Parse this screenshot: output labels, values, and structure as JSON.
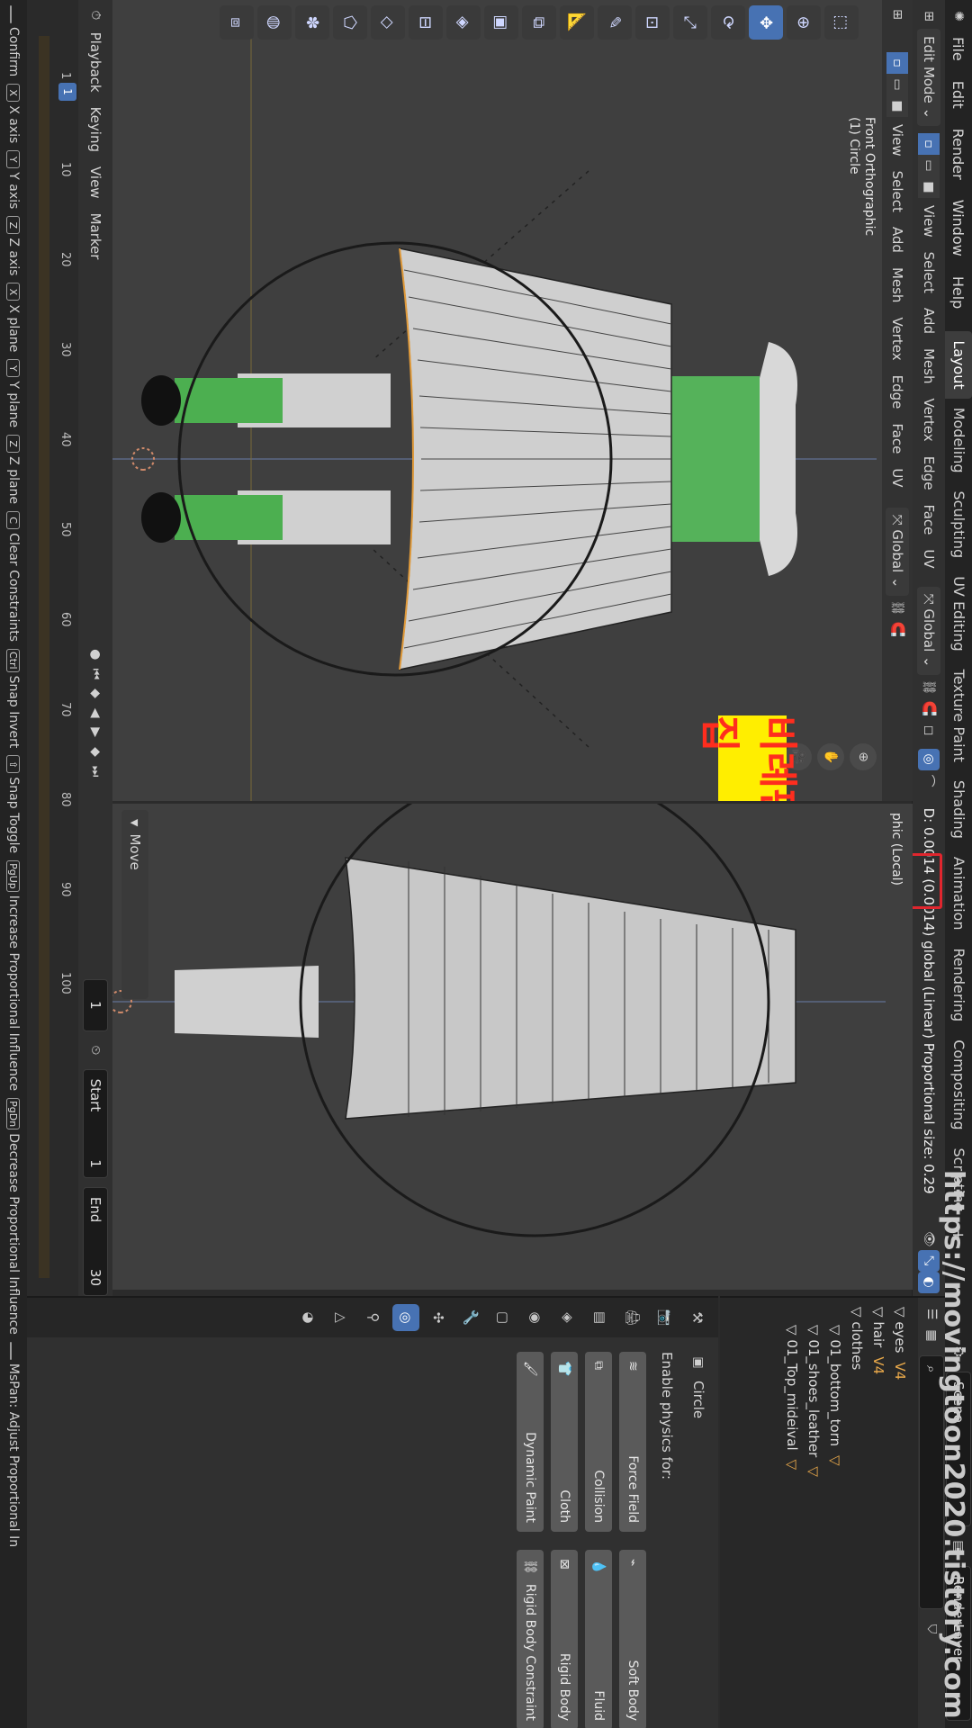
{
  "topbar": {
    "menus": [
      "File",
      "Edit",
      "Render",
      "Window",
      "Help"
    ],
    "workspaces": [
      "Layout",
      "Modeling",
      "Sculpting",
      "UV Editing",
      "Texture Paint",
      "Shading",
      "Animation",
      "Rendering",
      "Compositing",
      "Scripting"
    ],
    "active_workspace": "Layout",
    "scene": "Scene",
    "view_layer": "RenderLayer"
  },
  "header3d": {
    "mode": "Edit Mode",
    "menus": [
      "View",
      "Select",
      "Add",
      "Mesh",
      "Vertex",
      "Edge",
      "Face",
      "UV"
    ],
    "orientation": "Global",
    "operator_info": "D: 0.0014 (0.0014) global (Linear)  Proportional size: 0.29"
  },
  "left_view": {
    "mode": "Edit Mode",
    "menus": [
      "View",
      "Select",
      "Add",
      "Mesh",
      "Vertex",
      "Edge",
      "Face",
      "UV"
    ],
    "orientation": "Global",
    "label_line1": "Front Orthographic",
    "label_line2": "(1) Circle"
  },
  "right_view": {
    "label_line1": "Front Orthographic",
    "label_line2": "(1) Circle",
    "label_right": "phic (Local)"
  },
  "top_strip": {
    "label_line1": "Front Orthographic",
    "label_line2": "(1) Circle",
    "mode": "Edit Mo"
  },
  "move_panel": {
    "title": "Move"
  },
  "timeline": {
    "menus": [
      "Playback",
      "Keying",
      "View",
      "Marker"
    ],
    "current_frame": "1",
    "start_label": "Start",
    "start": "1",
    "end_label": "End",
    "end": "30",
    "ticks": [
      "1",
      "10",
      "20",
      "30",
      "40",
      "50",
      "60",
      "70",
      "80",
      "90",
      "100"
    ]
  },
  "outliner": {
    "rows": [
      {
        "name": "eyes",
        "tag": "V4"
      },
      {
        "name": "hair",
        "tag": "V4"
      },
      {
        "name": "clothes",
        "tag": ""
      },
      {
        "name": "01_bottom_torn",
        "tag": "▽"
      },
      {
        "name": "01_shoes_leather",
        "tag": "▽"
      },
      {
        "name": "01_Top_mideival",
        "tag": "▽"
      }
    ]
  },
  "properties": {
    "object": "Circle",
    "heading": "Enable physics for:",
    "buttons": [
      "Force Field",
      "Soft Body",
      "Collision",
      "Fluid",
      "Cloth",
      "Rigid Body",
      "Dynamic Paint",
      "Rigid Body Constraint"
    ]
  },
  "statusbar": {
    "items": [
      {
        "key": "",
        "label": "Confirm"
      },
      {
        "key": "X",
        "label": "X axis"
      },
      {
        "key": "Y",
        "label": "Y axis"
      },
      {
        "key": "Z",
        "label": "Z axis"
      },
      {
        "key": "X",
        "label": "X plane"
      },
      {
        "key": "Y",
        "label": "Y plane"
      },
      {
        "key": "Z",
        "label": "Z plane"
      },
      {
        "key": "C",
        "label": "Clear Constraints"
      },
      {
        "key": "Ctrl",
        "label": "Snap Invert"
      },
      {
        "key": "⇧",
        "label": "Snap Toggle"
      },
      {
        "key": "PgUp",
        "label": "Increase Proportional Influence"
      },
      {
        "key": "PgDn",
        "label": "Decrease Proportional Influence"
      },
      {
        "key": "",
        "label": "MsPan: Adjust Proportional In"
      }
    ]
  },
  "overlay_label": "비례편집",
  "watermark": "https://movingtoon2020.tistory.com",
  "corner_mark": "11",
  "colors": {
    "accent": "#4772b3",
    "highlight_box": "#e0262e",
    "overlay_bg": "#ffee00",
    "overlay_text": "#ff2d1e",
    "mesh_green": "#4caf50"
  },
  "icons": [
    "blender-logo-icon",
    "proportional-edit-icon",
    "falloff-icon",
    "snap-icon",
    "gear-icon",
    "search-icon",
    "filter-icon",
    "move-icon",
    "rotate-icon",
    "scale-icon",
    "cursor-icon",
    "select-box-icon"
  ]
}
